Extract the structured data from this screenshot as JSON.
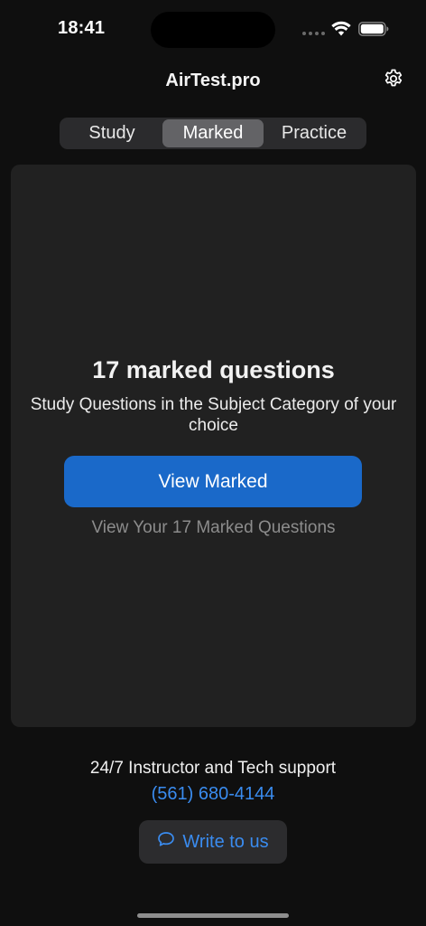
{
  "status_bar": {
    "time": "18:41",
    "icons": [
      "cellular-dots-icon",
      "wifi-icon",
      "battery-icon"
    ]
  },
  "nav": {
    "title": "AirTest.pro",
    "settings_icon": "gear-icon"
  },
  "segmented": {
    "tabs": [
      {
        "label": "Study",
        "selected": false
      },
      {
        "label": "Marked",
        "selected": true
      },
      {
        "label": "Practice",
        "selected": false
      }
    ]
  },
  "card": {
    "title": "17 marked questions",
    "subtitle": "Study Questions in the Subject Category of your choice",
    "button_label": "View Marked",
    "hint": "View Your 17 Marked Questions"
  },
  "footer": {
    "support_text": "24/7 Instructor and Tech support",
    "phone": "(561) 680-4144",
    "write_label": "Write to us",
    "write_icon": "chat-bubble-icon"
  },
  "colors": {
    "background": "#0f0f0f",
    "card": "#212121",
    "accent": "#1a69c9",
    "link": "#3a8cf0",
    "segment_selected": "#636366"
  }
}
